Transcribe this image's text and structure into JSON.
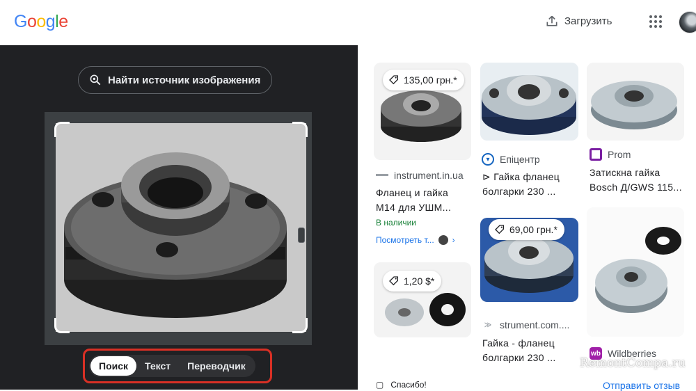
{
  "header": {
    "logo_letters": [
      {
        "ch": "G",
        "color": "#4285F4"
      },
      {
        "ch": "o",
        "color": "#EA4335"
      },
      {
        "ch": "o",
        "color": "#FBBC05"
      },
      {
        "ch": "g",
        "color": "#4285F4"
      },
      {
        "ch": "l",
        "color": "#34A853"
      },
      {
        "ch": "e",
        "color": "#EA4335"
      }
    ],
    "upload_label": "Загрузить",
    "upload_icon": "upload-icon",
    "apps_icon": "apps-grid-icon"
  },
  "left_panel": {
    "find_source_label": "Найти источник изображения",
    "find_source_icon": "lens-search-icon",
    "tabs": [
      {
        "label": "Поиск",
        "active": true
      },
      {
        "label": "Текст",
        "active": false
      },
      {
        "label": "Переводчик",
        "active": false
      }
    ],
    "highlight_color": "#d93025"
  },
  "results": {
    "cards": [
      {
        "price": "135,00 грн.*",
        "source": "instrument.in.ua",
        "title_line1": "Фланец и гайка",
        "title_line2": "М14 для УШМ...",
        "stock": "В наличии",
        "view_more": "Посмотреть т..."
      },
      {
        "source": "Епіцентр",
        "title_line1": "⊳ Гайка фланец",
        "title_line2": "болгарки 230 ..."
      },
      {
        "source": "Prom",
        "title_line1": "Затискна гайка",
        "title_line2": "Bosch Д/GWS 115..."
      },
      {
        "price": "69,00 грн.*",
        "source": "strument.com....",
        "title_line1": "Гайка - фланец",
        "title_line2": "болгарки 230 ..."
      },
      {
        "price": "1,20 $*"
      },
      {
        "source": "Wildberries"
      }
    ],
    "thanks": "Спасибо!",
    "feedback": "Отправить отзыв"
  },
  "watermark": "RemontCompa.ru"
}
